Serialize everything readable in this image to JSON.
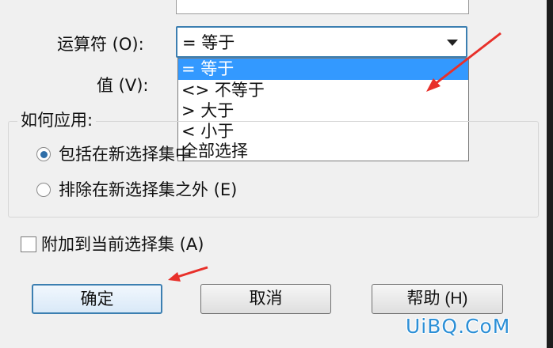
{
  "filter": {
    "operator_label": "运算符 (O):",
    "value_label": "值 (V):",
    "operator_selected": "= 等于",
    "operator_options": [
      "= 等于",
      "<> 不等于",
      "> 大于",
      "< 小于",
      "全部选择"
    ]
  },
  "apply": {
    "legend": "如何应用:",
    "include_label": "包括在新选择集中",
    "exclude_label": "排除在新选择集之外 (E)",
    "include_selected": true
  },
  "append_label": "附加到当前选择集 (A)",
  "buttons": {
    "ok": "确定",
    "cancel": "取消",
    "help": "帮助 (H)"
  },
  "watermark": "UiBQ.CoM",
  "colors": {
    "highlight": "#3399ff",
    "annotation_arrow": "#e8302a",
    "watermark": "#2c8fd6"
  }
}
